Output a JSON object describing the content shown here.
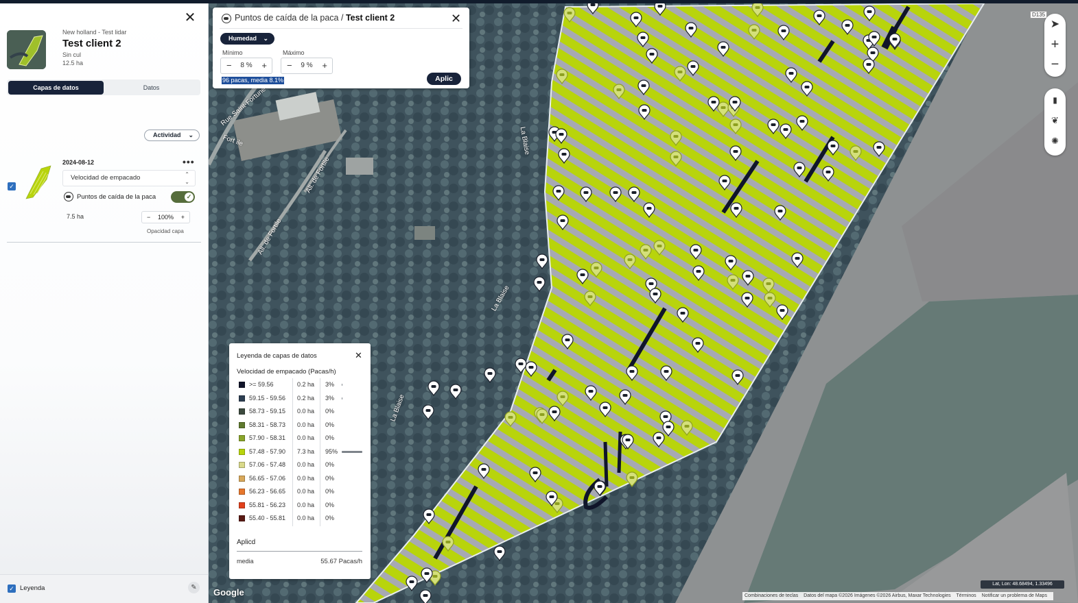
{
  "field": {
    "org": "New holland - Test lidar",
    "name": "Test client 2",
    "crop": "Sin cul",
    "area": "12.5 ha"
  },
  "tabs": [
    {
      "label": "Capas de datos",
      "active": true
    },
    {
      "label": "Datos",
      "active": false
    }
  ],
  "activity_filter": {
    "label": "Actividad"
  },
  "layer": {
    "date": "2024-08-12",
    "selected_metric": "Velocidad de empacado",
    "sublayer_label": "Puntos de caída de la paca",
    "sublayer_enabled": true,
    "checked": true,
    "area": "7.5 ha",
    "opacity_value": "100%",
    "opacity_label": "Opacidad capa"
  },
  "legend_footer": {
    "label": "Leyenda",
    "checked": true
  },
  "bale_panel": {
    "title_prefix": "Puntos de caída de la paca /",
    "title_field": "Test client 2",
    "filter_label": "Humedad",
    "min_label": "Mínimo",
    "max_label": "Máximo",
    "min_value": "8",
    "max_value": "9",
    "unit": "%",
    "summary": "96 pacas, media 8.1%",
    "apply_label": "Aplic"
  },
  "legend": {
    "title": "Leyenda de capas de datos",
    "subtitle": "Velocidad de empacado (Pacas/h)",
    "rows": [
      {
        "range": ">= 59.56",
        "ha": "0.2 ha",
        "pct": "3%",
        "share": 0.03,
        "color": "#10152a"
      },
      {
        "range": "59.15 - 59.56",
        "ha": "0.2 ha",
        "pct": "3%",
        "share": 0.03,
        "color": "#2d3e52"
      },
      {
        "range": "58.73 - 59.15",
        "ha": "0.0 ha",
        "pct": "0%",
        "share": 0,
        "color": "#3c4a3e"
      },
      {
        "range": "58.31 - 58.73",
        "ha": "0.0 ha",
        "pct": "0%",
        "share": 0,
        "color": "#5f7a2e"
      },
      {
        "range": "57.90 - 58.31",
        "ha": "0.0 ha",
        "pct": "0%",
        "share": 0,
        "color": "#8aa52a"
      },
      {
        "range": "57.48 - 57.90",
        "ha": "7.3 ha",
        "pct": "95%",
        "share": 0.95,
        "color": "#b8d40c"
      },
      {
        "range": "57.06 - 57.48",
        "ha": "0.0 ha",
        "pct": "0%",
        "share": 0,
        "color": "#d9d98a"
      },
      {
        "range": "56.65 - 57.06",
        "ha": "0.0 ha",
        "pct": "0%",
        "share": 0,
        "color": "#d8a85a"
      },
      {
        "range": "56.23 - 56.65",
        "ha": "0.0 ha",
        "pct": "0%",
        "share": 0,
        "color": "#e7772d"
      },
      {
        "range": "55.81 - 56.23",
        "ha": "0.0 ha",
        "pct": "0%",
        "share": 0,
        "color": "#e2401c"
      },
      {
        "range": "55.40 - 55.81",
        "ha": "0.0 ha",
        "pct": "0%",
        "share": 0,
        "color": "#5a1a14"
      }
    ],
    "applied_label": "Aplicd",
    "mean_label": "media",
    "mean_value": "55.67 Pacas/h"
  },
  "map": {
    "google_label": "Google",
    "road_label": "D135",
    "coords": "Lat, Lon: 48.68494, 1.33496",
    "attribution": [
      "Combinaciones de teclas",
      "Datos del mapa ©2026 Imágenes ©2026 Airbus, Maxar Technologies",
      "Términos",
      "Notificar un problema de Maps"
    ],
    "streets": [
      "Rue Saint-Fortune",
      "Fort ile",
      "All. de Fortile",
      "All. de Fortile",
      "La Blaise",
      "La Blaise",
      "La Blaise"
    ]
  },
  "controls": {
    "nav": [
      "locate-icon",
      "zoom-in-icon",
      "zoom-out-icon"
    ],
    "layers": [
      "map-type-icon",
      "crop-layer-icon",
      "weather-icon"
    ]
  },
  "colors": {
    "accent_dark": "#18233a",
    "toggle_green": "#566d3c",
    "field_fill": "#b8d40c",
    "check_blue": "#2e6fbe"
  }
}
